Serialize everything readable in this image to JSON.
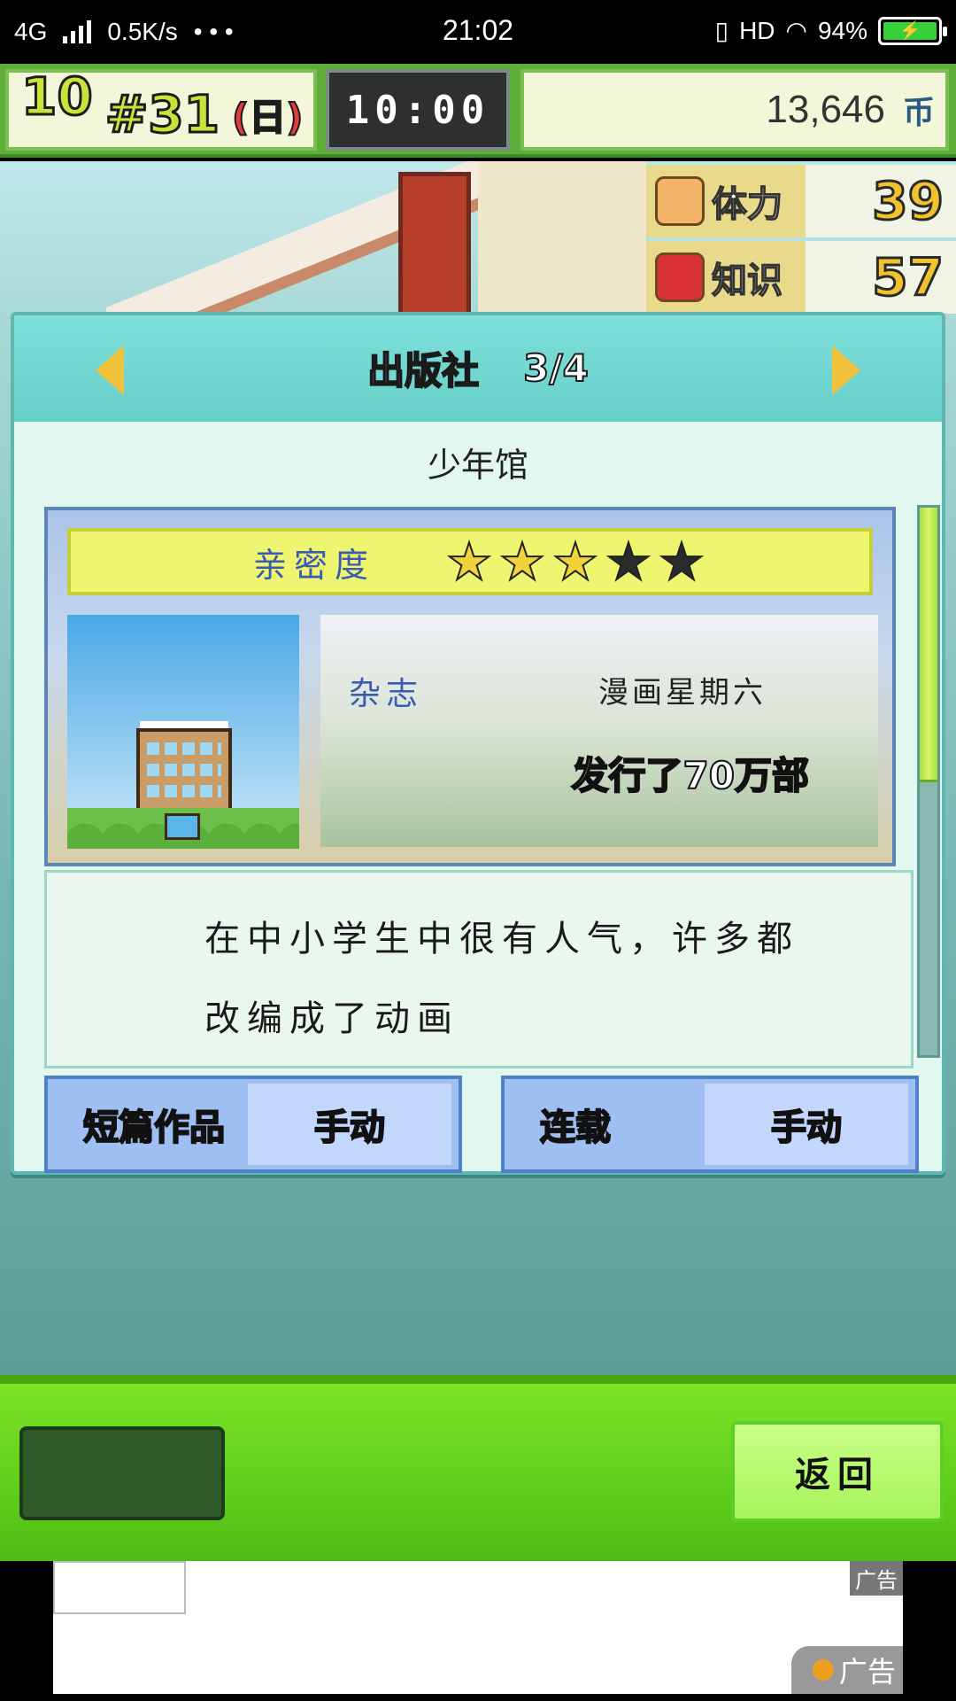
{
  "status_bar": {
    "network": "4G",
    "speed": "0.5K/s",
    "dots": "• • •",
    "time": "21:02",
    "hd": "HD",
    "battery": "94%",
    "battery_bolt": "⚡"
  },
  "header": {
    "month": "10",
    "day": "#31",
    "weekday": "(日)",
    "clock": "10:00",
    "money": "13,646",
    "money_unit": "币"
  },
  "stats": [
    {
      "label": "体力",
      "value": "39",
      "icon": "muscle-icon"
    },
    {
      "label": "知识",
      "value": "57",
      "icon": "book-icon"
    }
  ],
  "dialog": {
    "title": "出版社",
    "page": "3/4",
    "company": "少年馆",
    "intimacy_label": "亲密度",
    "intimacy_rating": 3,
    "intimacy_max": 5,
    "magazine_label": "杂志",
    "magazine_name": "漫画星期六",
    "issued": "发行了70万部",
    "description_line1": "在中小学生中很有人气，许多都",
    "description_line2": "改编成了动画",
    "options": [
      {
        "label": "短篇作品",
        "value": "手动"
      },
      {
        "label": "连载",
        "value": "手动"
      }
    ]
  },
  "bottom": {
    "back_label": "返回"
  },
  "ad": {
    "tag": "广告",
    "badge": "广告"
  }
}
